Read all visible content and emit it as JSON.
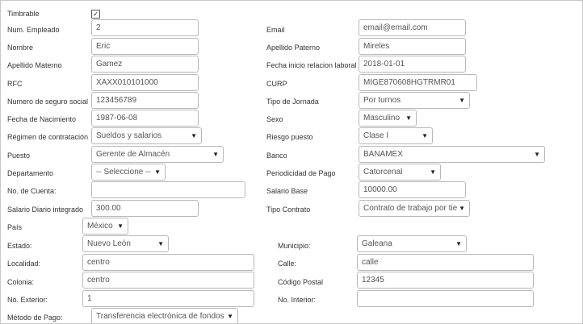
{
  "timbrable": {
    "label": "Timbrable",
    "checked_mark": "✓"
  },
  "num_empleado": {
    "label": "Num. Empleado",
    "value": "2"
  },
  "email": {
    "label": "Email",
    "value": "email@email.com"
  },
  "nombre": {
    "label": "Nombre",
    "value": "Eric"
  },
  "apellido_paterno": {
    "label": "Apellido Paterno",
    "value": "Mireles"
  },
  "apellido_materno": {
    "label": "Apellido Materno",
    "value": "Gamez"
  },
  "fecha_inicio": {
    "label": "Fecha inicio relacion laboral",
    "value": "2018-01-01"
  },
  "rfc": {
    "label": "RFC",
    "value": "XAXX010101000"
  },
  "curp": {
    "label": "CURP",
    "value": "MIGE870608HGTRMR01"
  },
  "nss": {
    "label": "Numero de seguro social",
    "value": "123456789"
  },
  "tipo_jornada": {
    "label": "Tipo de Jornada",
    "value": "Por turnos"
  },
  "fecha_nacimiento": {
    "label": "Fecha de Nacimiento",
    "value": "1987-06-08"
  },
  "sexo": {
    "label": "Sexo",
    "value": "Masculino"
  },
  "regimen": {
    "label": "Régimen de contratación",
    "value": "Sueldos y salarios"
  },
  "riesgo": {
    "label": "Riesgo puesto",
    "value": "Clase I"
  },
  "puesto": {
    "label": "Puesto",
    "value": "Gerente de Almacén"
  },
  "banco": {
    "label": "Banco",
    "value": "BANAMEX"
  },
  "departamento": {
    "label": "Departamento",
    "value": "-- Seleccione --"
  },
  "periodicidad": {
    "label": "Periodicidad de Pago",
    "value": "Catorcenal"
  },
  "no_cuenta": {
    "label": "No. de Cuenta:",
    "value": ""
  },
  "salario_base": {
    "label": "Salario Base",
    "value": "10000.00"
  },
  "salario_diario": {
    "label": "Salario Diario integrado",
    "value": "300.00"
  },
  "tipo_contrato": {
    "label": "Tipo Contrato",
    "value": "Contrato de trabajo por tie"
  },
  "pais": {
    "label": "País",
    "value": "México"
  },
  "estado": {
    "label": "Estado:",
    "value": "Nuevo León"
  },
  "municipio": {
    "label": "Municipio:",
    "value": "Galeana"
  },
  "localidad": {
    "label": "Localidad:",
    "value": "centro"
  },
  "calle": {
    "label": "Calle:",
    "value": "calle"
  },
  "colonia": {
    "label": "Colonia:",
    "value": "centro"
  },
  "codigo_postal": {
    "label": "Código Postal",
    "value": "12345"
  },
  "no_exterior": {
    "label": "No. Exterior:",
    "value": "1"
  },
  "no_interior": {
    "label": "No. Interior:",
    "value": ""
  },
  "metodo_pago": {
    "label": "Método de Pago:",
    "value": "Transferencia electrónica de fondos"
  },
  "icons": {
    "dropdown_caret": "▼"
  }
}
